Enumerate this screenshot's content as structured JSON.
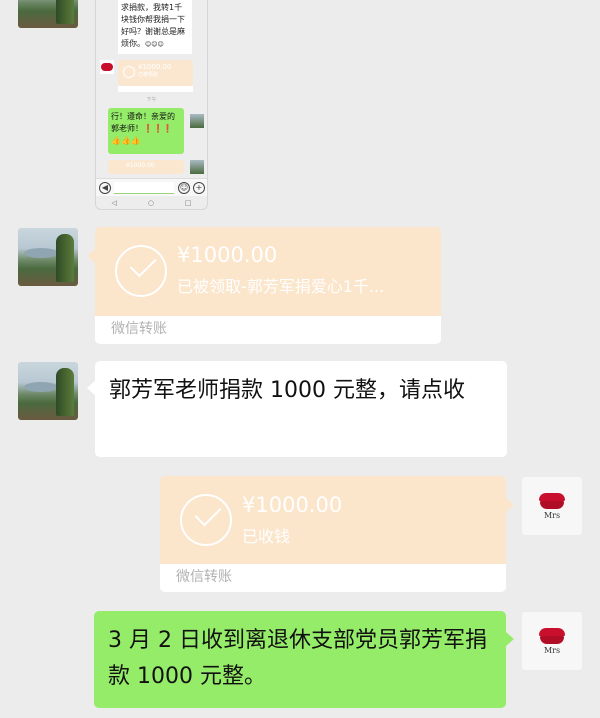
{
  "shot": {
    "text_lines": [
      "求捐款，我转1千",
      "块钱你帮我捐一下",
      "好吗？谢谢总是麻",
      "烦你。"
    ],
    "emoji": "😊😊😊",
    "pay_amount": "¥1000.00",
    "pay_sub": "已被领取",
    "timestamp": "下午",
    "reply_lines": [
      "行！遵命！亲爱的",
      "郭老师！❗❗❗",
      "👍👍👍"
    ],
    "pay2_amount": "¥1000.00",
    "nav": [
      "◁",
      "○",
      "□"
    ]
  },
  "messages": {
    "transfer1": {
      "amount": "¥1000.00",
      "desc": "已被领取-郭芳军捐爱心1千...",
      "footer": "微信转账"
    },
    "text1": "郭芳军老师捐款 1000 元整，请点收",
    "transfer2": {
      "amount": "¥1000.00",
      "desc": "已收钱",
      "footer": "微信转账"
    },
    "text2": "3 月 2 日收到离退休支部党员郭芳军捐款 1000 元整。"
  },
  "avatars": {
    "mrs_label": "Mrs"
  },
  "colors": {
    "chat_bg": "#ececec",
    "transfer_orange": "#fbe5cb",
    "green_bubble": "#95ec69"
  }
}
